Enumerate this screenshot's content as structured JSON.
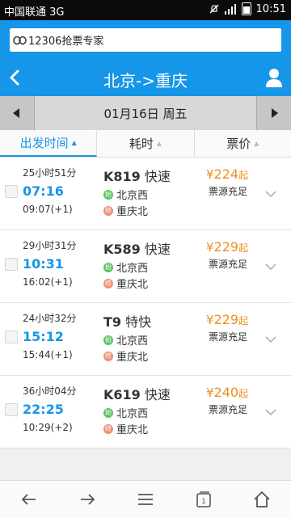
{
  "statusbar": {
    "carrier": "中国联通 3G",
    "time": "10:51"
  },
  "ad": {
    "text": "12306抢票专家"
  },
  "header": {
    "title": "北京->重庆"
  },
  "datebar": {
    "date": "01月16日 周五"
  },
  "sort": {
    "departure": "出发时间",
    "duration": "耗时",
    "price": "票价"
  },
  "trains": [
    {
      "duration": "25小时51分",
      "depart": "07:16",
      "arrive": "09:07(+1)",
      "number": "K819",
      "type": "快速",
      "from_badge": "始",
      "from": "北京西",
      "to_badge": "终",
      "to": "重庆北",
      "yen": "¥",
      "price": "224",
      "price_suffix": "起",
      "availability": "票源充足"
    },
    {
      "duration": "29小时31分",
      "depart": "10:31",
      "arrive": "16:02(+1)",
      "number": "K589",
      "type": "快速",
      "from_badge": "始",
      "from": "北京西",
      "to_badge": "终",
      "to": "重庆北",
      "yen": "¥",
      "price": "229",
      "price_suffix": "起",
      "availability": "票源充足"
    },
    {
      "duration": "24小时32分",
      "depart": "15:12",
      "arrive": "15:44(+1)",
      "number": "T9",
      "type": "特快",
      "from_badge": "始",
      "from": "北京西",
      "to_badge": "终",
      "to": "重庆北",
      "yen": "¥",
      "price": "229",
      "price_suffix": "起",
      "availability": "票源充足"
    },
    {
      "duration": "36小时04分",
      "depart": "22:25",
      "arrive": "10:29(+2)",
      "number": "K619",
      "type": "快速",
      "from_badge": "始",
      "from": "北京西",
      "to_badge": "终",
      "to": "重庆北",
      "yen": "¥",
      "price": "240",
      "price_suffix": "起",
      "availability": "票源充足"
    }
  ],
  "bottom": {
    "icons": [
      "arrow-left-icon",
      "arrow-right-icon",
      "menu-icon",
      "tabs-icon",
      "home-icon"
    ]
  },
  "colors": {
    "accent": "#1596e8",
    "price": "#f08e1e",
    "origin_badge": "#58c55e",
    "terminal_badge": "#ef9072"
  }
}
